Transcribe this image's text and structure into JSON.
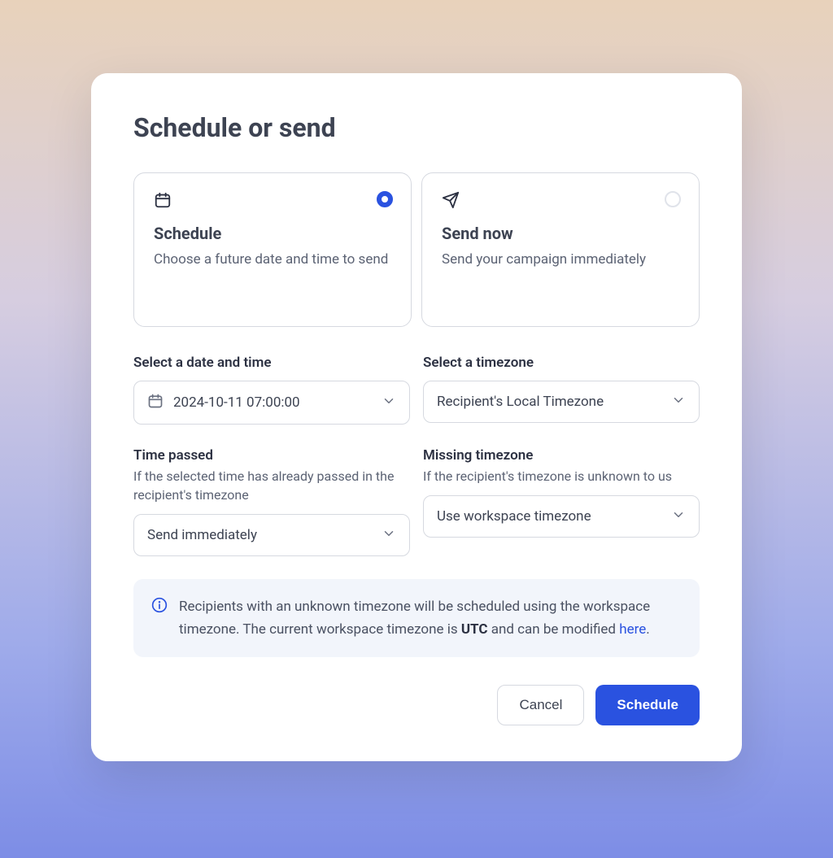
{
  "modal": {
    "title": "Schedule or send",
    "options": {
      "schedule": {
        "title": "Schedule",
        "description": "Choose a future date and time to send",
        "selected": true
      },
      "send_now": {
        "title": "Send now",
        "description": "Send your campaign immediately",
        "selected": false
      }
    },
    "fields": {
      "datetime": {
        "label": "Select a date and time",
        "value": "2024-10-11 07:00:00"
      },
      "timezone": {
        "label": "Select a timezone",
        "value": "Recipient's Local Timezone"
      },
      "time_passed": {
        "label": "Time passed",
        "sublabel": "If the selected time has already passed in the recipient's timezone",
        "value": "Send immediately"
      },
      "missing_tz": {
        "label": "Missing timezone",
        "sublabel": "If the recipient's timezone is unknown to us",
        "value": "Use workspace timezone"
      }
    },
    "info": {
      "text_before_bold": "Recipients with an unknown timezone will be scheduled using the workspace timezone. The current workspace timezone is ",
      "bold": "UTC",
      "text_after_bold": " and can be modified ",
      "link_text": "here",
      "period": "."
    },
    "buttons": {
      "cancel": "Cancel",
      "schedule": "Schedule"
    }
  }
}
